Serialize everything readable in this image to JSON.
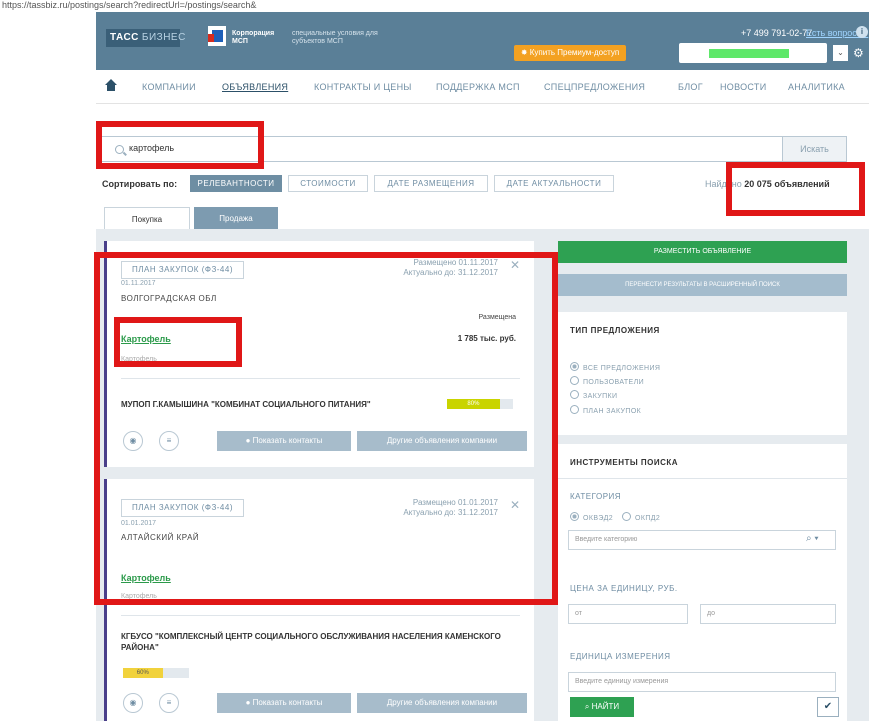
{
  "url": "https://tassbiz.ru/postings/search?redirectUrl=/postings/search&",
  "header": {
    "logo_tass": "ТАСС",
    "logo_biz": "БИЗНЕС",
    "corp_title": "Корпорация МСП",
    "corp_sub": "специальные условия для субъектов МСП",
    "phone": "+7 499 791-02-77",
    "question_link": "Есть вопросы?",
    "premium": "Купить Премиум-доступ",
    "brand_color": "#5a7f97"
  },
  "nav": {
    "items": [
      "КОМПАНИИ",
      "ОБЪЯВЛЕНИЯ",
      "КОНТРАКТЫ И ЦЕНЫ",
      "ПОДДЕРЖКА МСП",
      "СПЕЦПРЕДЛОЖЕНИЯ",
      "БЛОГ",
      "НОВОСТИ",
      "АНАЛИТИКА"
    ],
    "active": "ОБЪЯВЛЕНИЯ"
  },
  "search": {
    "value": "картофель",
    "button": "Искать"
  },
  "sort": {
    "label": "Сортировать по:",
    "options": [
      "РЕЛЕВАНТНОСТИ",
      "СТОИМОСТИ",
      "ДАТЕ РАЗМЕЩЕНИЯ",
      "ДАТЕ АКТУАЛЬНОСТИ"
    ],
    "active": "РЕЛЕВАНТНОСТИ",
    "found_prefix": "Найдено",
    "found_count": "20 075",
    "found_suffix": "объявлений"
  },
  "tabs": [
    "Покупка",
    "Продажа"
  ],
  "cards": [
    {
      "plan": "ПЛАН ЗАКУПОК (ФЗ-44)",
      "date": "01.11.2017",
      "placed": "Размещено 01.11.2017",
      "actual": "Актуально до: 31.12.2017",
      "region": "ВОЛГОГРАДСКАЯ ОБЛ",
      "title": "Картофель",
      "subtitle": "Картофель",
      "price_label": "Размещена",
      "price": "1 785 тыс. руб.",
      "company": "МУПОП Г.КАМЫШИНА \"КОМБИНАТ СОЦИАЛЬНОГО ПИТАНИЯ\"",
      "progress": 80,
      "progress_label": "80%",
      "progress_color": "#c9d400",
      "contacts_btn": "Показать контакты",
      "other_btn": "Другие объявления компании"
    },
    {
      "plan": "ПЛАН ЗАКУПОК (ФЗ-44)",
      "date": "01.01.2017",
      "placed": "Размещено 01.01.2017",
      "actual": "Актуально до: 31.12.2017",
      "region": "АЛТАЙСКИЙ КРАЙ",
      "title": "Картофель",
      "subtitle": "Картофель",
      "company": "КГБУСО \"КОМПЛЕКСНЫЙ ЦЕНТР СОЦИАЛЬНОГО ОБСЛУЖИВАНИЯ НАСЕЛЕНИЯ КАМЕНСКОГО РАЙОНА\"",
      "progress": 60,
      "progress_label": "60%",
      "progress_color": "#f1d23c",
      "contacts_btn": "Показать контакты",
      "other_btn": "Другие объявления компании"
    }
  ],
  "sidebar": {
    "place_btn": "РАЗМЕСТИТЬ ОБЪЯВЛЕНИЕ",
    "save_btn": "ПЕРЕНЕСТИ РЕЗУЛЬТАТЫ В РАСШИРЕННЫЙ ПОИСК",
    "offer_type_title": "ТИП ПРЕДЛОЖЕНИЯ",
    "offer_types": [
      "ВСЕ ПРЕДЛОЖЕНИЯ",
      "ПОЛЬЗОВАТЕЛИ",
      "ЗАКУПКИ",
      "ПЛАН ЗАКУПОК"
    ],
    "tools_title": "ИНСТРУМЕНТЫ ПОИСКА",
    "category_title": "КАТЕГОРИЯ",
    "category_radio": [
      "ОКВЭД2",
      "ОКПД2"
    ],
    "category_placeholder": "Введите категорию",
    "price_title": "ЦЕНА ЗА ЕДИНИЦУ, РУБ.",
    "price_from": "от",
    "price_to": "до",
    "unit_title": "ЕДИНИЦА ИЗМЕРЕНИЯ",
    "unit_placeholder": "Введите единицу измерения",
    "find_btn": "НАЙТИ"
  },
  "accent_green": "#2ea152",
  "highlight_color": "#e01717"
}
